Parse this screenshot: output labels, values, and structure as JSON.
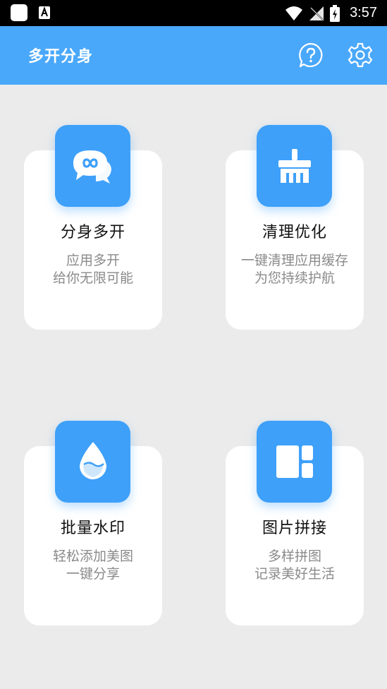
{
  "status_bar": {
    "time": "3:57",
    "icons": [
      "app-square-icon",
      "text-a-icon",
      "wifi-icon",
      "no-signal-icon",
      "battery-charging-icon"
    ]
  },
  "app_bar": {
    "title": "多开分身",
    "help_icon": "help-circle-icon",
    "settings_icon": "gear-icon",
    "background": "#4aa8fb"
  },
  "features": [
    {
      "title": "分身多开",
      "desc_line1": "应用多开",
      "desc_line2": "给你无限可能",
      "icon": "chat-infinity-icon"
    },
    {
      "title": "清理优化",
      "desc_line1": "一键清理应用缓存",
      "desc_line2": "为您持续护航",
      "icon": "broom-icon"
    },
    {
      "title": "批量水印",
      "desc_line1": "轻松添加美图",
      "desc_line2": "一键分享",
      "icon": "water-drop-icon"
    },
    {
      "title": "图片拼接",
      "desc_line1": "多样拼图",
      "desc_line2": "记录美好生活",
      "icon": "grid-collage-icon"
    }
  ],
  "colors": {
    "accent": "#3ea0f9",
    "page_bg": "#ebebeb",
    "card_bg": "#ffffff",
    "desc_text": "#8a8a8a"
  }
}
